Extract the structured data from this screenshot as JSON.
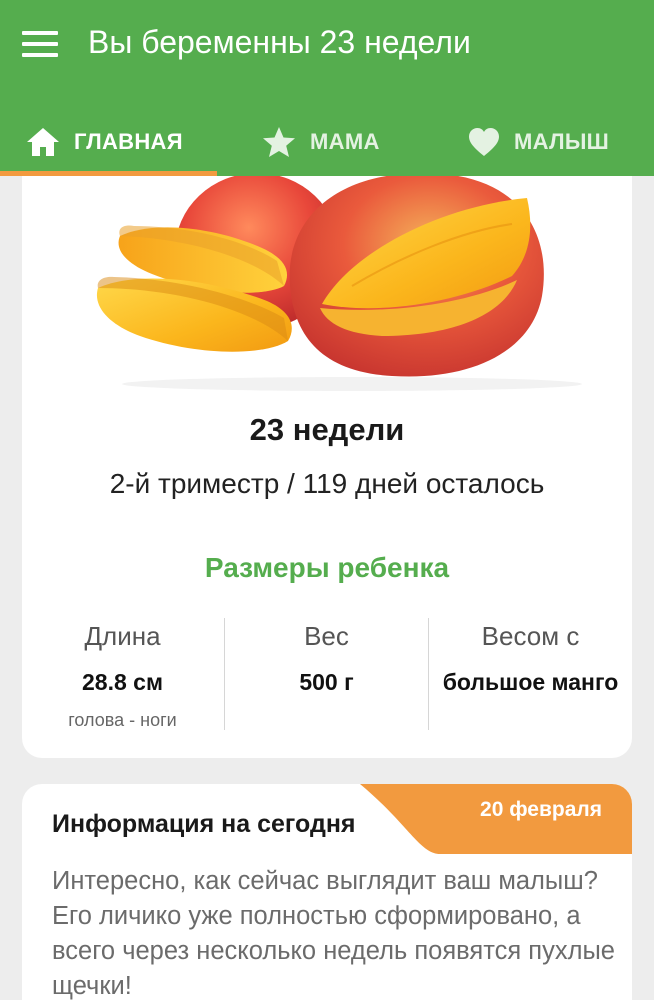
{
  "app_bar": {
    "title": "Вы беременны 23 недели",
    "background": "#55ad4e"
  },
  "tabs": [
    {
      "label": "ГЛАВНАЯ",
      "icon": "home-icon",
      "selected": true
    },
    {
      "label": "МАМА",
      "icon": "star-icon",
      "selected": false
    },
    {
      "label": "МАЛЫШ",
      "icon": "heart-icon",
      "selected": false
    }
  ],
  "accent_color": "#f29a3f",
  "week_card": {
    "image": "mango-fruit",
    "week_title": "23 недели",
    "trimester_text": "2-й триместр / 119 дней осталось",
    "sizes_title": "Размеры ребенка",
    "stats": [
      {
        "label": "Длина",
        "value": "28.8 см",
        "note": "голова - ноги"
      },
      {
        "label": "Вес",
        "value": "500 г"
      },
      {
        "label": "Весом с",
        "value": "большое манго"
      }
    ]
  },
  "info_card": {
    "title": "Информация на сегодня",
    "date": "20 февраля",
    "text": "Интересно, как сейчас выглядит ваш малыш? Его личико уже полностью сформировано, а всего через несколько недель появятся пухлые щечки!"
  }
}
